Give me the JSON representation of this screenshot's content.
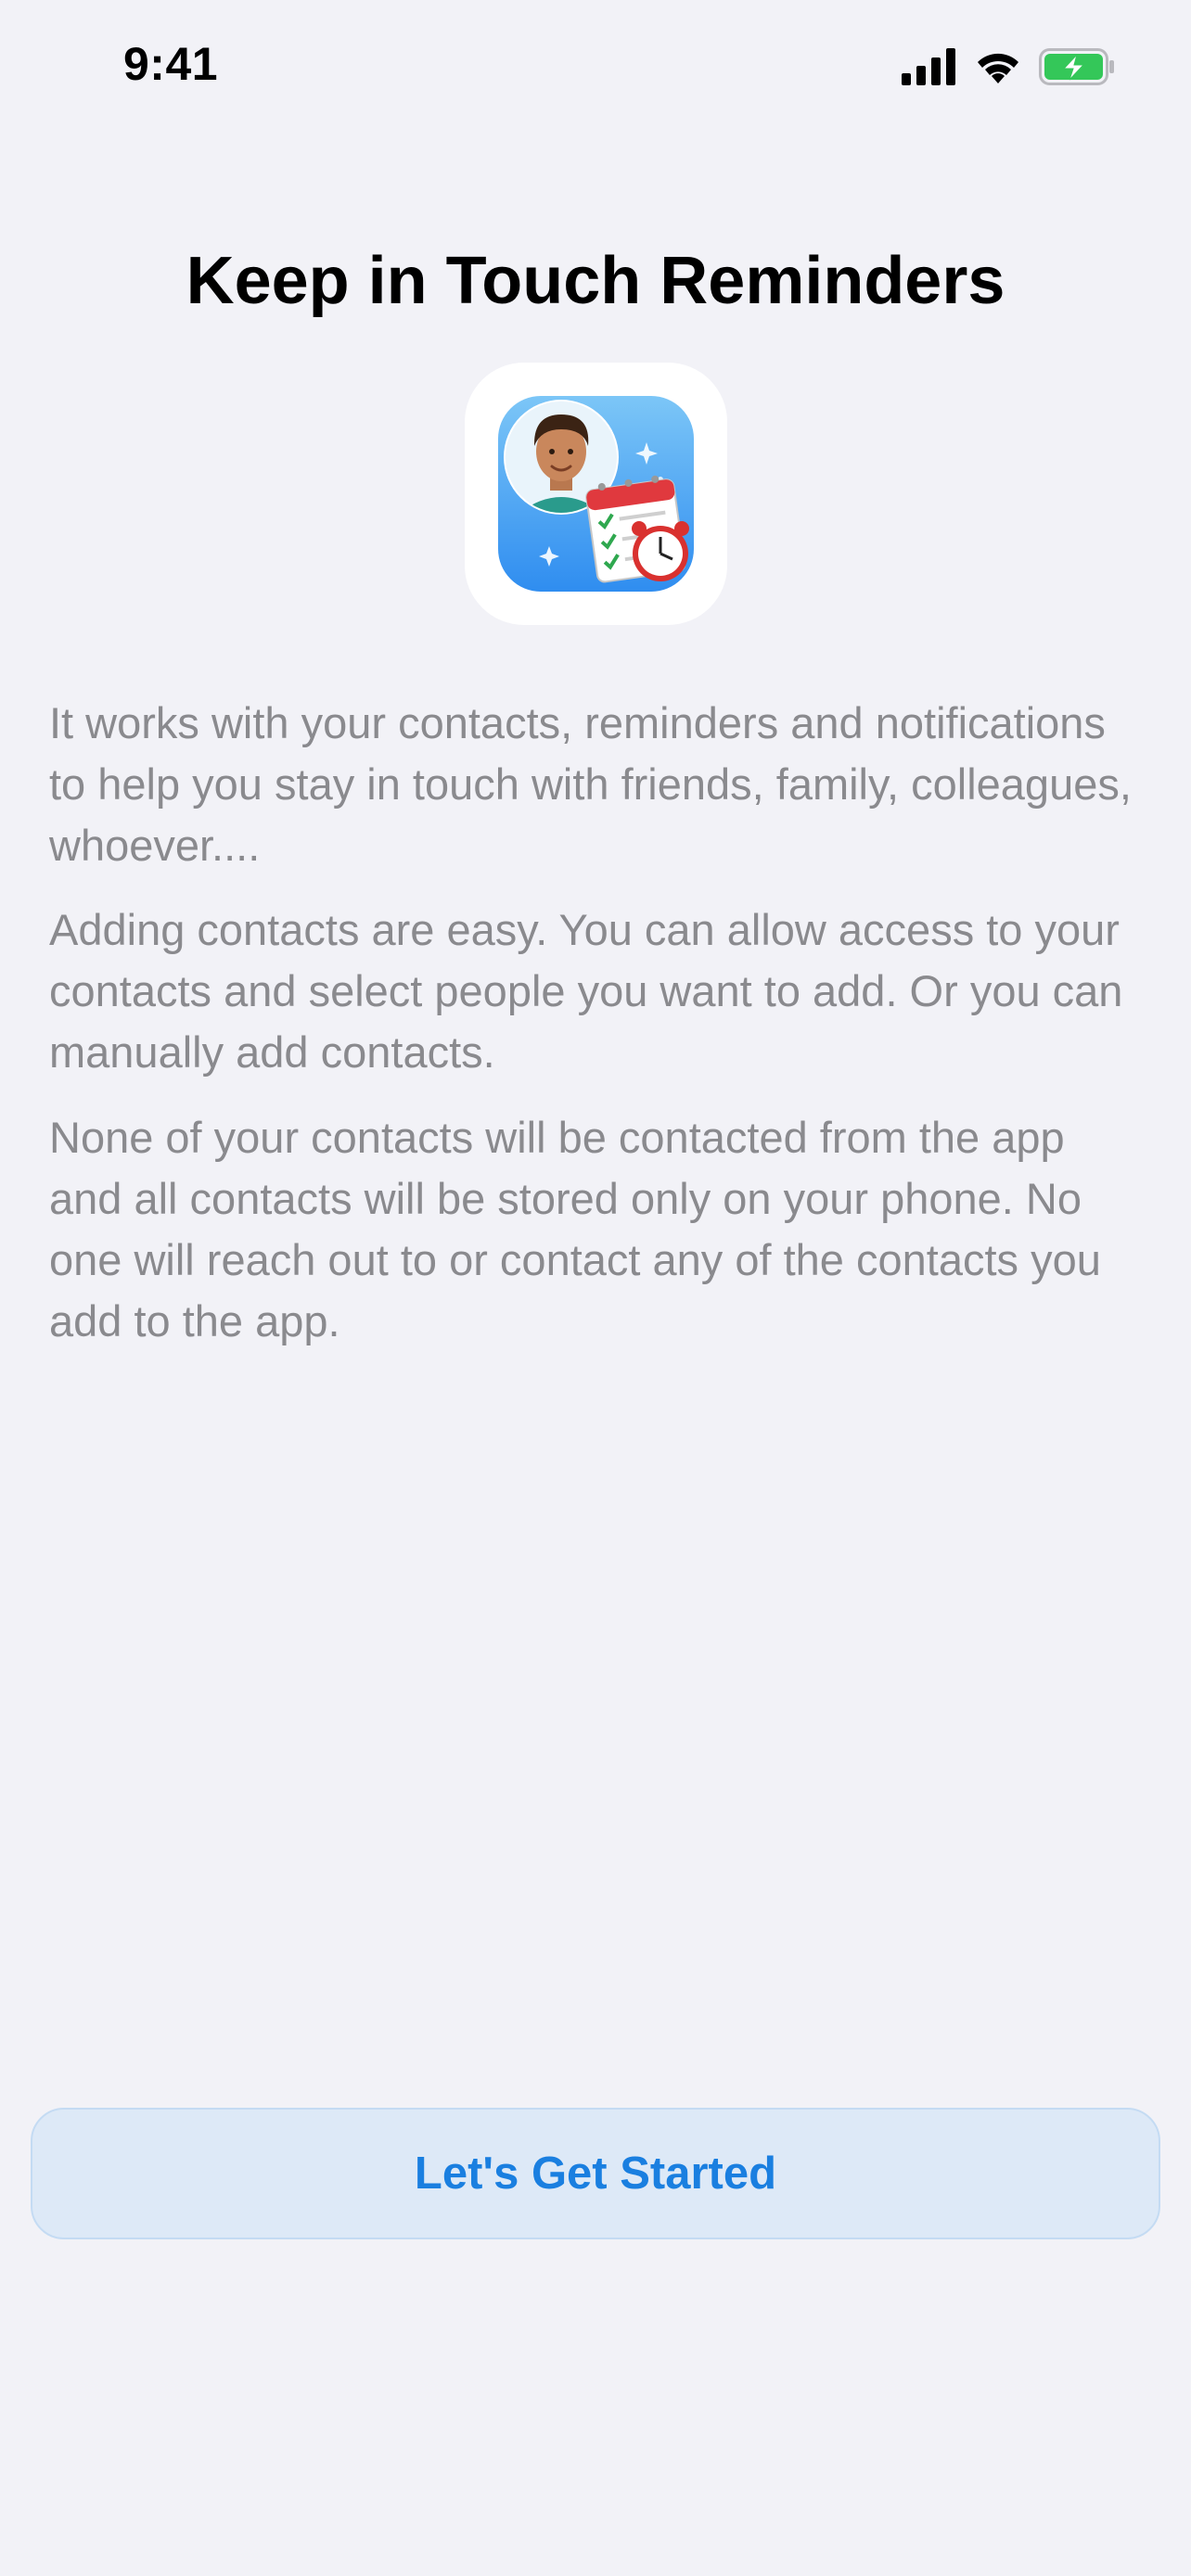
{
  "status_bar": {
    "time": "9:41",
    "signal_icon": "cellular-signal-icon",
    "wifi_icon": "wifi-icon",
    "battery_icon": "battery-charging-icon",
    "battery_color": "#34c759"
  },
  "onboarding": {
    "title": "Keep in Touch Reminders",
    "app_icon": "app-icon",
    "paragraphs": [
      "It works with your contacts, reminders and notifications to help you stay in touch with friends, family, colleagues, whoever....",
      "Adding contacts are easy. You can allow access to your contacts and select people you want to add. Or you can manually add contacts.",
      "None of your contacts will be contacted from the app and all contacts will be stored only on your phone. No one will reach out to or contact any of the contacts you add to the app."
    ],
    "cta_label": "Let's Get Started"
  },
  "colors": {
    "background": "#f2f2f7",
    "accent": "#1a7fe0",
    "button_background": "#dde9f7",
    "body_text": "#8a8a8e"
  }
}
